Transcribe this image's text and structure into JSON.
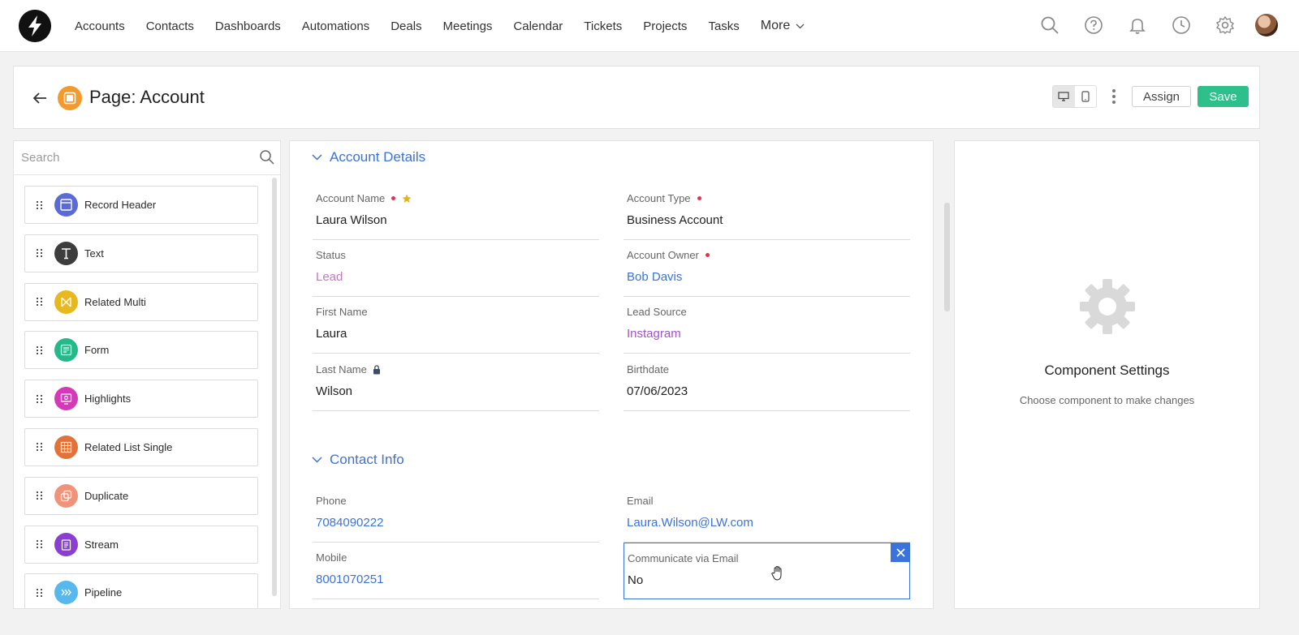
{
  "nav": {
    "links": [
      "Accounts",
      "Contacts",
      "Dashboards",
      "Automations",
      "Deals",
      "Meetings",
      "Calendar",
      "Tickets",
      "Projects",
      "Tasks"
    ],
    "more_label": "More",
    "icons": [
      "search-icon",
      "help-icon",
      "bell-icon",
      "clock-icon",
      "gear-icon"
    ]
  },
  "header": {
    "title": "Page: Account",
    "assign_label": "Assign",
    "save_label": "Save",
    "device_active": "desktop"
  },
  "components": {
    "search_placeholder": "Search",
    "items": [
      {
        "label": "Record Header",
        "icon": "record-header-icon",
        "color": "#5a6bd6"
      },
      {
        "label": "Text",
        "icon": "text-icon",
        "color": "#3d3d3d"
      },
      {
        "label": "Related Multi",
        "icon": "related-multi-icon",
        "color": "#e8b81f"
      },
      {
        "label": "Form",
        "icon": "form-icon",
        "color": "#25b98a"
      },
      {
        "label": "Highlights",
        "icon": "highlights-icon",
        "color": "#d43ab8"
      },
      {
        "label": "Related List Single",
        "icon": "related-list-icon",
        "color": "#e0733c"
      },
      {
        "label": "Duplicate",
        "icon": "duplicate-icon",
        "color": "#f0937a"
      },
      {
        "label": "Stream",
        "icon": "stream-icon",
        "color": "#8a3fd1"
      },
      {
        "label": "Pipeline",
        "icon": "pipeline-icon",
        "color": "#56b8ec"
      }
    ]
  },
  "account_details": {
    "title": "Account Details",
    "fields": {
      "account_name": {
        "label": "Account Name",
        "value": "Laura Wilson"
      },
      "account_type": {
        "label": "Account Type",
        "value": "Business Account"
      },
      "status": {
        "label": "Status",
        "value": "Lead"
      },
      "account_owner": {
        "label": "Account Owner",
        "value": "Bob Davis"
      },
      "first_name": {
        "label": "First Name",
        "value": "Laura"
      },
      "lead_source": {
        "label": "Lead Source",
        "value": "Instagram"
      },
      "last_name": {
        "label": "Last Name",
        "value": "Wilson"
      },
      "birthdate": {
        "label": "Birthdate",
        "value": "07/06/2023"
      }
    }
  },
  "contact_info": {
    "title": "Contact Info",
    "fields": {
      "phone": {
        "label": "Phone",
        "value": "7084090222"
      },
      "email": {
        "label": "Email",
        "value": "Laura.Wilson@LW.com"
      },
      "mobile": {
        "label": "Mobile",
        "value": "8001070251"
      },
      "communicate_email": {
        "label": "Communicate via Email",
        "value": "No"
      }
    }
  },
  "settings": {
    "title": "Component Settings",
    "subtitle": "Choose component to make changes"
  }
}
